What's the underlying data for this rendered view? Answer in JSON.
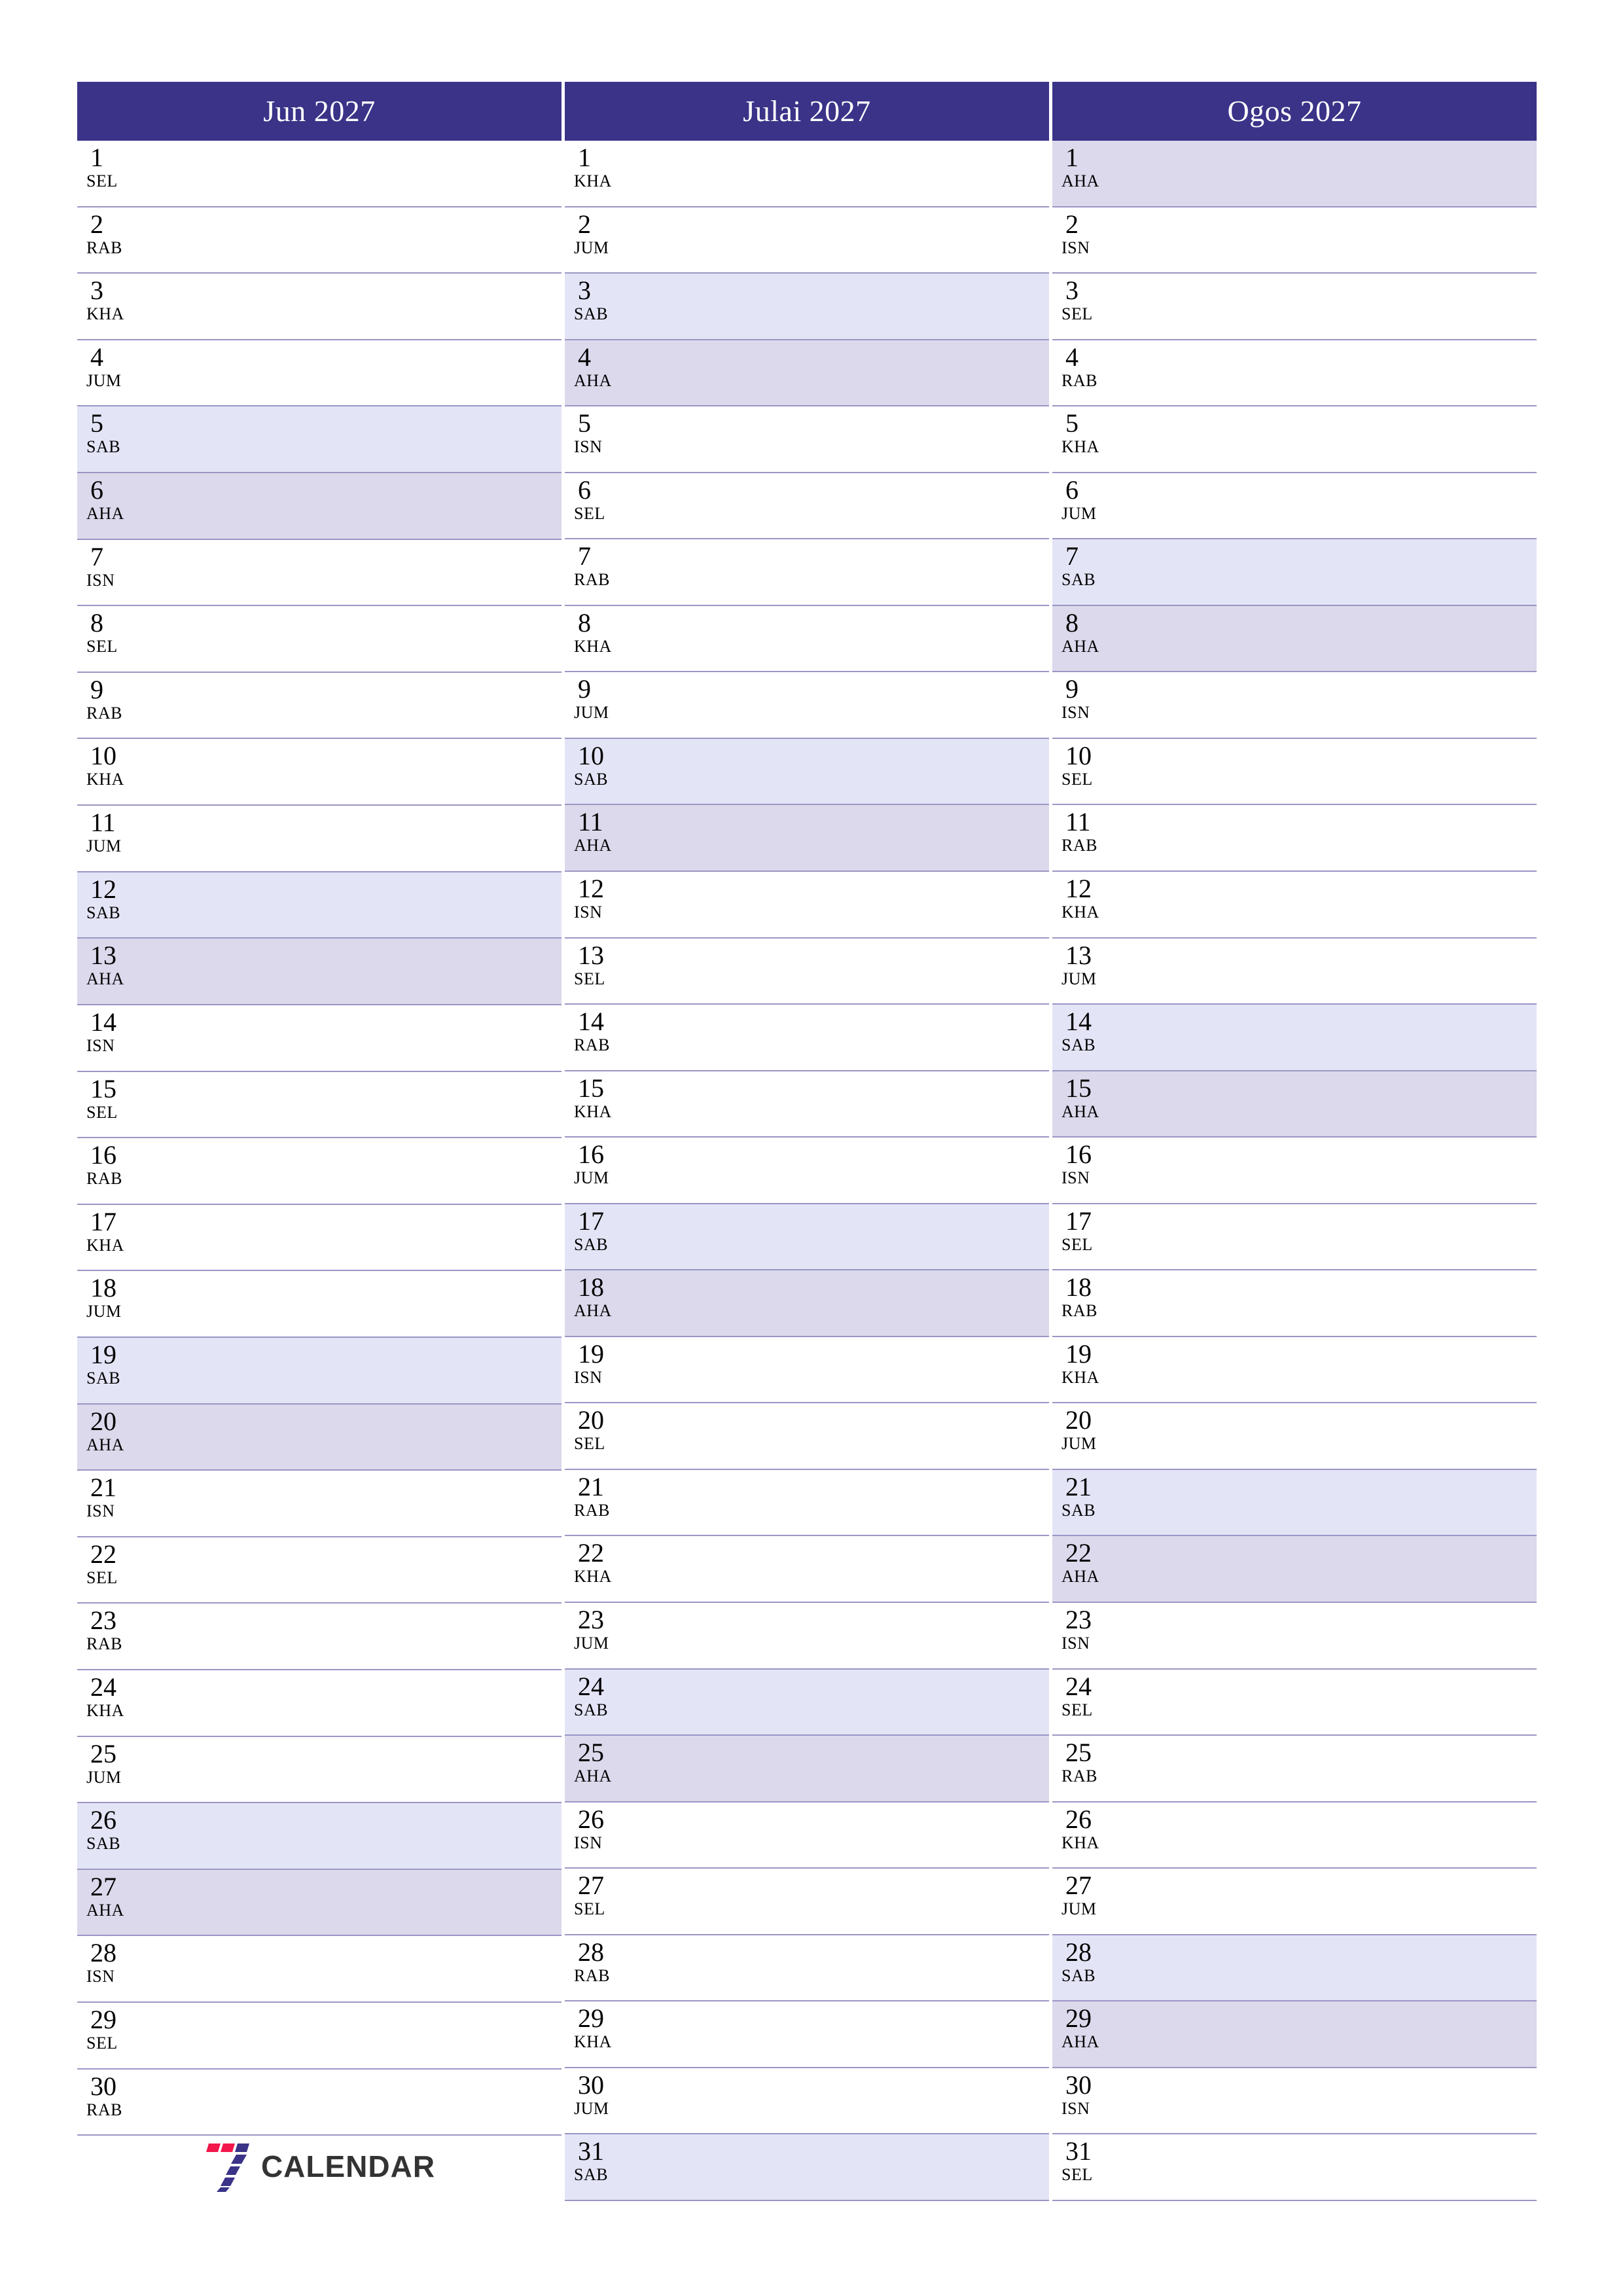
{
  "document": {
    "type": "three-month-planner",
    "language": "ms",
    "year": "2027"
  },
  "colors": {
    "header_bg": "#3a3388",
    "header_text": "#ffffff",
    "saturday_bg": "#e4e4f7",
    "sunday_bg": "#dcd9ec",
    "row_rule": "#9a96c4",
    "page_bg": "#ffffff",
    "logo_red": "#f2164b",
    "logo_purple": "#3a3388",
    "logo_text": "#333333"
  },
  "logo": {
    "mark_name": "seven-logo-icon",
    "text": "CALENDAR"
  },
  "months": [
    {
      "title": "Jun 2027",
      "days": [
        {
          "num": "1",
          "abbr": "SEL",
          "kind": "weekday"
        },
        {
          "num": "2",
          "abbr": "RAB",
          "kind": "weekday"
        },
        {
          "num": "3",
          "abbr": "KHA",
          "kind": "weekday"
        },
        {
          "num": "4",
          "abbr": "JUM",
          "kind": "weekday"
        },
        {
          "num": "5",
          "abbr": "SAB",
          "kind": "sat"
        },
        {
          "num": "6",
          "abbr": "AHA",
          "kind": "sun"
        },
        {
          "num": "7",
          "abbr": "ISN",
          "kind": "weekday"
        },
        {
          "num": "8",
          "abbr": "SEL",
          "kind": "weekday"
        },
        {
          "num": "9",
          "abbr": "RAB",
          "kind": "weekday"
        },
        {
          "num": "10",
          "abbr": "KHA",
          "kind": "weekday"
        },
        {
          "num": "11",
          "abbr": "JUM",
          "kind": "weekday"
        },
        {
          "num": "12",
          "abbr": "SAB",
          "kind": "sat"
        },
        {
          "num": "13",
          "abbr": "AHA",
          "kind": "sun"
        },
        {
          "num": "14",
          "abbr": "ISN",
          "kind": "weekday"
        },
        {
          "num": "15",
          "abbr": "SEL",
          "kind": "weekday"
        },
        {
          "num": "16",
          "abbr": "RAB",
          "kind": "weekday"
        },
        {
          "num": "17",
          "abbr": "KHA",
          "kind": "weekday"
        },
        {
          "num": "18",
          "abbr": "JUM",
          "kind": "weekday"
        },
        {
          "num": "19",
          "abbr": "SAB",
          "kind": "sat"
        },
        {
          "num": "20",
          "abbr": "AHA",
          "kind": "sun"
        },
        {
          "num": "21",
          "abbr": "ISN",
          "kind": "weekday"
        },
        {
          "num": "22",
          "abbr": "SEL",
          "kind": "weekday"
        },
        {
          "num": "23",
          "abbr": "RAB",
          "kind": "weekday"
        },
        {
          "num": "24",
          "abbr": "KHA",
          "kind": "weekday"
        },
        {
          "num": "25",
          "abbr": "JUM",
          "kind": "weekday"
        },
        {
          "num": "26",
          "abbr": "SAB",
          "kind": "sat"
        },
        {
          "num": "27",
          "abbr": "AHA",
          "kind": "sun"
        },
        {
          "num": "28",
          "abbr": "ISN",
          "kind": "weekday"
        },
        {
          "num": "29",
          "abbr": "SEL",
          "kind": "weekday"
        },
        {
          "num": "30",
          "abbr": "RAB",
          "kind": "weekday"
        },
        {
          "num": "",
          "abbr": "",
          "kind": "empty"
        }
      ]
    },
    {
      "title": "Julai 2027",
      "days": [
        {
          "num": "1",
          "abbr": "KHA",
          "kind": "weekday"
        },
        {
          "num": "2",
          "abbr": "JUM",
          "kind": "weekday"
        },
        {
          "num": "3",
          "abbr": "SAB",
          "kind": "sat"
        },
        {
          "num": "4",
          "abbr": "AHA",
          "kind": "sun"
        },
        {
          "num": "5",
          "abbr": "ISN",
          "kind": "weekday"
        },
        {
          "num": "6",
          "abbr": "SEL",
          "kind": "weekday"
        },
        {
          "num": "7",
          "abbr": "RAB",
          "kind": "weekday"
        },
        {
          "num": "8",
          "abbr": "KHA",
          "kind": "weekday"
        },
        {
          "num": "9",
          "abbr": "JUM",
          "kind": "weekday"
        },
        {
          "num": "10",
          "abbr": "SAB",
          "kind": "sat"
        },
        {
          "num": "11",
          "abbr": "AHA",
          "kind": "sun"
        },
        {
          "num": "12",
          "abbr": "ISN",
          "kind": "weekday"
        },
        {
          "num": "13",
          "abbr": "SEL",
          "kind": "weekday"
        },
        {
          "num": "14",
          "abbr": "RAB",
          "kind": "weekday"
        },
        {
          "num": "15",
          "abbr": "KHA",
          "kind": "weekday"
        },
        {
          "num": "16",
          "abbr": "JUM",
          "kind": "weekday"
        },
        {
          "num": "17",
          "abbr": "SAB",
          "kind": "sat"
        },
        {
          "num": "18",
          "abbr": "AHA",
          "kind": "sun"
        },
        {
          "num": "19",
          "abbr": "ISN",
          "kind": "weekday"
        },
        {
          "num": "20",
          "abbr": "SEL",
          "kind": "weekday"
        },
        {
          "num": "21",
          "abbr": "RAB",
          "kind": "weekday"
        },
        {
          "num": "22",
          "abbr": "KHA",
          "kind": "weekday"
        },
        {
          "num": "23",
          "abbr": "JUM",
          "kind": "weekday"
        },
        {
          "num": "24",
          "abbr": "SAB",
          "kind": "sat"
        },
        {
          "num": "25",
          "abbr": "AHA",
          "kind": "sun"
        },
        {
          "num": "26",
          "abbr": "ISN",
          "kind": "weekday"
        },
        {
          "num": "27",
          "abbr": "SEL",
          "kind": "weekday"
        },
        {
          "num": "28",
          "abbr": "RAB",
          "kind": "weekday"
        },
        {
          "num": "29",
          "abbr": "KHA",
          "kind": "weekday"
        },
        {
          "num": "30",
          "abbr": "JUM",
          "kind": "weekday"
        },
        {
          "num": "31",
          "abbr": "SAB",
          "kind": "sat"
        }
      ]
    },
    {
      "title": "Ogos 2027",
      "days": [
        {
          "num": "1",
          "abbr": "AHA",
          "kind": "sun"
        },
        {
          "num": "2",
          "abbr": "ISN",
          "kind": "weekday"
        },
        {
          "num": "3",
          "abbr": "SEL",
          "kind": "weekday"
        },
        {
          "num": "4",
          "abbr": "RAB",
          "kind": "weekday"
        },
        {
          "num": "5",
          "abbr": "KHA",
          "kind": "weekday"
        },
        {
          "num": "6",
          "abbr": "JUM",
          "kind": "weekday"
        },
        {
          "num": "7",
          "abbr": "SAB",
          "kind": "sat"
        },
        {
          "num": "8",
          "abbr": "AHA",
          "kind": "sun"
        },
        {
          "num": "9",
          "abbr": "ISN",
          "kind": "weekday"
        },
        {
          "num": "10",
          "abbr": "SEL",
          "kind": "weekday"
        },
        {
          "num": "11",
          "abbr": "RAB",
          "kind": "weekday"
        },
        {
          "num": "12",
          "abbr": "KHA",
          "kind": "weekday"
        },
        {
          "num": "13",
          "abbr": "JUM",
          "kind": "weekday"
        },
        {
          "num": "14",
          "abbr": "SAB",
          "kind": "sat"
        },
        {
          "num": "15",
          "abbr": "AHA",
          "kind": "sun"
        },
        {
          "num": "16",
          "abbr": "ISN",
          "kind": "weekday"
        },
        {
          "num": "17",
          "abbr": "SEL",
          "kind": "weekday"
        },
        {
          "num": "18",
          "abbr": "RAB",
          "kind": "weekday"
        },
        {
          "num": "19",
          "abbr": "KHA",
          "kind": "weekday"
        },
        {
          "num": "20",
          "abbr": "JUM",
          "kind": "weekday"
        },
        {
          "num": "21",
          "abbr": "SAB",
          "kind": "sat"
        },
        {
          "num": "22",
          "abbr": "AHA",
          "kind": "sun"
        },
        {
          "num": "23",
          "abbr": "ISN",
          "kind": "weekday"
        },
        {
          "num": "24",
          "abbr": "SEL",
          "kind": "weekday"
        },
        {
          "num": "25",
          "abbr": "RAB",
          "kind": "weekday"
        },
        {
          "num": "26",
          "abbr": "KHA",
          "kind": "weekday"
        },
        {
          "num": "27",
          "abbr": "JUM",
          "kind": "weekday"
        },
        {
          "num": "28",
          "abbr": "SAB",
          "kind": "sat"
        },
        {
          "num": "29",
          "abbr": "AHA",
          "kind": "sun"
        },
        {
          "num": "30",
          "abbr": "ISN",
          "kind": "weekday"
        },
        {
          "num": "31",
          "abbr": "SEL",
          "kind": "weekday"
        }
      ]
    }
  ]
}
